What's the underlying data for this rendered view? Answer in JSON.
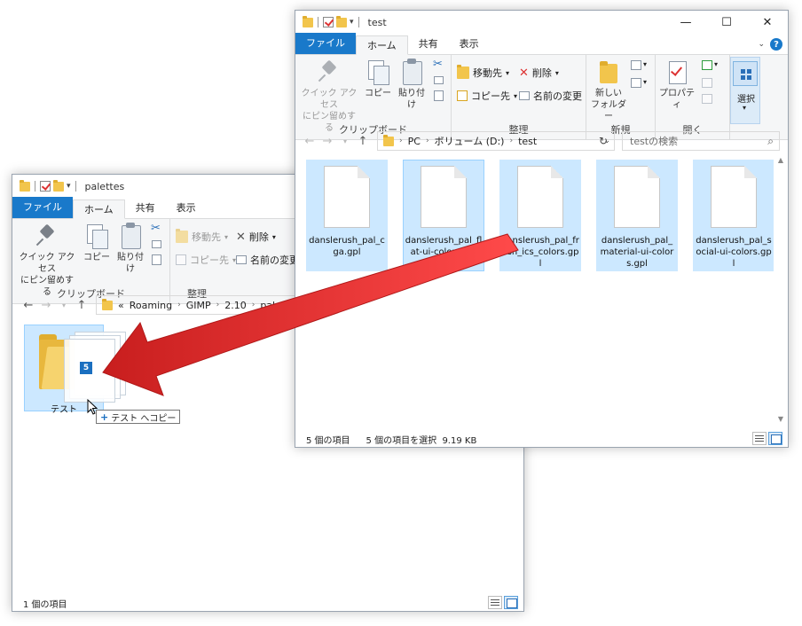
{
  "back_window": {
    "title": "palettes",
    "tabs": [
      "ファイル",
      "ホーム",
      "共有",
      "表示"
    ],
    "clipboard": {
      "pin_label": "クイック アクセス\nにピン留めする",
      "copy_label": "コピー",
      "paste_label": "貼り付け",
      "group_label": "クリップボード"
    },
    "organize": {
      "move_label": "移動先",
      "copy_to_label": "コピー先",
      "delete_label": "削除",
      "rename_label": "名前の変更",
      "group_label": "整理"
    },
    "breadcrumb": [
      "«",
      "Roaming",
      "GIMP",
      "2.10",
      "palettes"
    ],
    "folder_name": "テスト",
    "drag_count": "5",
    "drag_tooltip_verb": "テスト へコピー",
    "status_count": "1 個の項目"
  },
  "front_window": {
    "title": "test",
    "tabs": [
      "ファイル",
      "ホーム",
      "共有",
      "表示"
    ],
    "clipboard": {
      "pin_label": "クイック アクセス\nにピン留めする",
      "copy_label": "コピー",
      "paste_label": "貼り付け",
      "group_label": "クリップボード"
    },
    "organize": {
      "move_label": "移動先",
      "copy_to_label": "コピー先",
      "delete_label": "削除",
      "rename_label": "名前の変更",
      "group_label": "整理"
    },
    "new_group": {
      "new_folder_label": "新しい\nフォルダー",
      "group_label": "新規"
    },
    "open_group": {
      "properties_label": "プロパティ",
      "group_label": "開く"
    },
    "select_label": "選択",
    "breadcrumb": [
      "PC",
      "ボリューム (D:)",
      "test"
    ],
    "search_placeholder": "testの検索",
    "files": [
      "danslerush_pal_cga.gpl",
      "danslerush_pal_flat-ui-colors.gpl",
      "danslerush_pal_fresh_ics_colors.gpl",
      "danslerush_pal_material-ui-colors.gpl",
      "danslerush_pal_social-ui-colors.gpl"
    ],
    "status_count": "5 個の項目",
    "status_selected": "5 個の項目を選択  9.19 KB"
  },
  "colors": {
    "accent": "#1979ca",
    "selection": "#cce8ff",
    "arrow": "#e02b2b"
  }
}
